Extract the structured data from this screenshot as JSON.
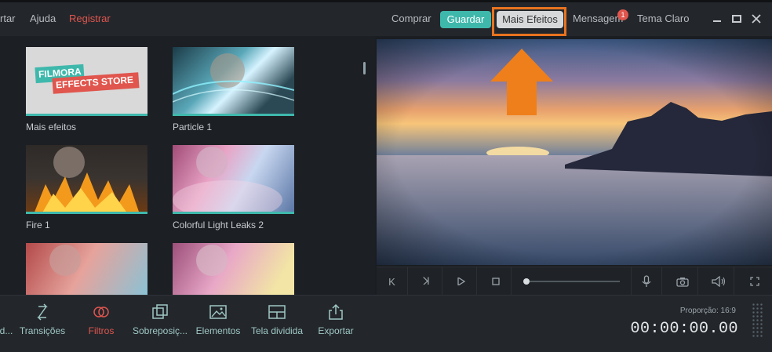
{
  "topbar": {
    "menu_left": [
      "rtar",
      "Ajuda",
      "Registrar"
    ],
    "comprar": "Comprar",
    "guardar": "Guardar",
    "mais_efeitos": "Mais Efeitos",
    "mensagem": "Mensagem",
    "mensagem_badge": "1",
    "tema": "Tema Claro"
  },
  "library": {
    "items": [
      {
        "label": "Mais efeitos",
        "logo_line1": "FILMORA",
        "logo_line2": "EFFECTS STORE"
      },
      {
        "label": "Particle 1"
      },
      {
        "label": "Fire 1"
      },
      {
        "label": "Colorful Light Leaks 2"
      },
      {
        "label": ""
      },
      {
        "label": ""
      }
    ]
  },
  "bottom": {
    "tools": [
      "d...",
      "Transições",
      "Filtros",
      "Sobreposiç...",
      "Elementos",
      "Tela dividida",
      "Exportar"
    ],
    "proporcao": "Proporção: 16:9",
    "timecode": "00:00:00.00"
  },
  "colors": {
    "accent": "#3fb8ac",
    "highlight": "#e8731f",
    "active_tool": "#e0554d"
  }
}
